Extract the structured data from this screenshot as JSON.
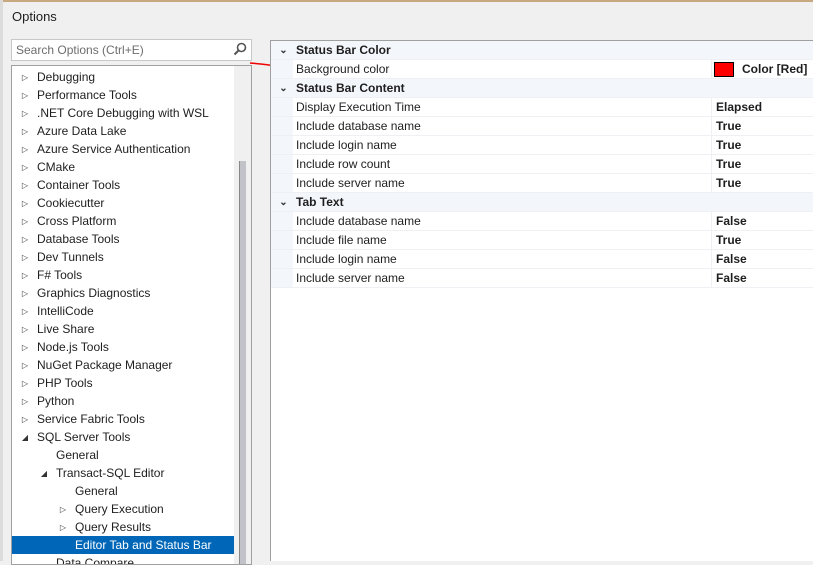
{
  "window": {
    "title": "Options"
  },
  "search": {
    "placeholder": "Search Options (Ctrl+E)"
  },
  "tree": [
    {
      "label": "Debugging",
      "level": 0,
      "exp": "collapsed"
    },
    {
      "label": "Performance Tools",
      "level": 0,
      "exp": "collapsed"
    },
    {
      "label": ".NET Core Debugging with WSL",
      "level": 0,
      "exp": "collapsed"
    },
    {
      "label": "Azure Data Lake",
      "level": 0,
      "exp": "collapsed"
    },
    {
      "label": "Azure Service Authentication",
      "level": 0,
      "exp": "collapsed"
    },
    {
      "label": "CMake",
      "level": 0,
      "exp": "collapsed"
    },
    {
      "label": "Container Tools",
      "level": 0,
      "exp": "collapsed"
    },
    {
      "label": "Cookiecutter",
      "level": 0,
      "exp": "collapsed"
    },
    {
      "label": "Cross Platform",
      "level": 0,
      "exp": "collapsed"
    },
    {
      "label": "Database Tools",
      "level": 0,
      "exp": "collapsed"
    },
    {
      "label": "Dev Tunnels",
      "level": 0,
      "exp": "collapsed"
    },
    {
      "label": "F# Tools",
      "level": 0,
      "exp": "collapsed"
    },
    {
      "label": "Graphics Diagnostics",
      "level": 0,
      "exp": "collapsed"
    },
    {
      "label": "IntelliCode",
      "level": 0,
      "exp": "collapsed"
    },
    {
      "label": "Live Share",
      "level": 0,
      "exp": "collapsed"
    },
    {
      "label": "Node.js Tools",
      "level": 0,
      "exp": "collapsed"
    },
    {
      "label": "NuGet Package Manager",
      "level": 0,
      "exp": "collapsed"
    },
    {
      "label": "PHP Tools",
      "level": 0,
      "exp": "collapsed"
    },
    {
      "label": "Python",
      "level": 0,
      "exp": "collapsed"
    },
    {
      "label": "Service Fabric Tools",
      "level": 0,
      "exp": "collapsed"
    },
    {
      "label": "SQL Server Tools",
      "level": 0,
      "exp": "expanded"
    },
    {
      "label": "General",
      "level": 1,
      "exp": "none"
    },
    {
      "label": "Transact-SQL Editor",
      "level": 1,
      "exp": "expanded"
    },
    {
      "label": "General",
      "level": 2,
      "exp": "none"
    },
    {
      "label": "Query Execution",
      "level": 2,
      "exp": "collapsed"
    },
    {
      "label": "Query Results",
      "level": 2,
      "exp": "collapsed"
    },
    {
      "label": "Editor Tab and Status Bar",
      "level": 2,
      "exp": "none",
      "selected": true
    },
    {
      "label": "Data Compare",
      "level": 1,
      "exp": "none"
    }
  ],
  "properties": [
    {
      "category": "Status Bar Color"
    },
    {
      "name": "Background color",
      "value": "Color [Red]",
      "color": "#ff0000"
    },
    {
      "category": "Status Bar Content"
    },
    {
      "name": "Display Execution Time",
      "value": "Elapsed"
    },
    {
      "name": "Include database name",
      "value": "True"
    },
    {
      "name": "Include login name",
      "value": "True"
    },
    {
      "name": "Include row count",
      "value": "True"
    },
    {
      "name": "Include server name",
      "value": "True"
    },
    {
      "category": "Tab Text"
    },
    {
      "name": "Include database name",
      "value": "False"
    },
    {
      "name": "Include file name",
      "value": "True"
    },
    {
      "name": "Include login name",
      "value": "False"
    },
    {
      "name": "Include server name",
      "value": "False"
    }
  ]
}
